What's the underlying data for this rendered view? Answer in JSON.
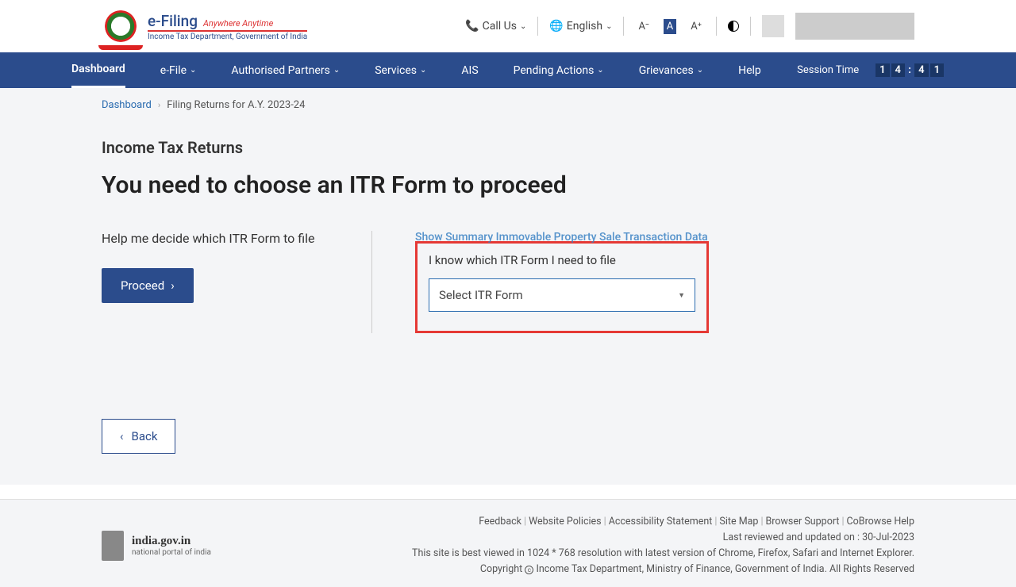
{
  "header": {
    "brand_title": "e-Filing",
    "brand_tag": "Anywhere Anytime",
    "brand_sub": "Income Tax Department, Government of India",
    "call_us": "Call Us",
    "language": "English"
  },
  "nav": {
    "items": [
      {
        "label": "Dashboard",
        "dropdown": false,
        "active": true
      },
      {
        "label": "e-File",
        "dropdown": true
      },
      {
        "label": "Authorised Partners",
        "dropdown": true
      },
      {
        "label": "Services",
        "dropdown": true
      },
      {
        "label": "AIS",
        "dropdown": false
      },
      {
        "label": "Pending Actions",
        "dropdown": true
      },
      {
        "label": "Grievances",
        "dropdown": true
      },
      {
        "label": "Help",
        "dropdown": false
      }
    ],
    "session_label": "Session Time",
    "session_time": {
      "m1": "1",
      "m2": "4",
      "s1": "4",
      "s2": "1"
    }
  },
  "breadcrumb": {
    "home": "Dashboard",
    "current": "Filing Returns for A.Y. 2023-24"
  },
  "page": {
    "subtitle": "Income Tax Returns",
    "title": "You need to choose an ITR Form to proceed",
    "help_text": "Help me decide which ITR Form to file",
    "proceed": "Proceed",
    "show_summary": "Show Summary Immovable Property Sale Transaction Data",
    "known_label": "I know which ITR Form I need to file",
    "select_placeholder": "Select ITR Form",
    "back": "Back"
  },
  "footer": {
    "india_title": "india.gov.in",
    "india_sub": "national portal of india",
    "links": [
      "Feedback",
      "Website Policies",
      "Accessibility Statement",
      "Site Map",
      "Browser Support",
      "CoBrowse Help"
    ],
    "updated_label": "Last reviewed and updated on :",
    "updated_date": "30-Jul-2023",
    "best_viewed": "This site is best viewed in 1024 * 768 resolution with latest version of Chrome, Firefox, Safari and Internet Explorer.",
    "copyright": "Copyright",
    "copyright_body": "Income Tax Department, Ministry of Finance, Government of India. All Rights Reserved"
  }
}
